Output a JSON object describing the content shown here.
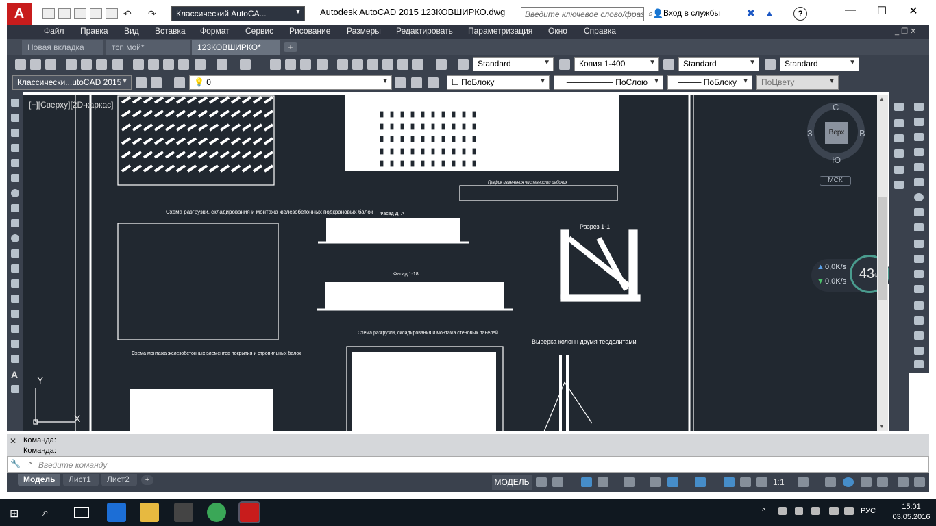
{
  "titlebar": {
    "logo": "A",
    "workspace": "Классический AutoCA...",
    "app_title": "Autodesk AutoCAD 2015    123КОВШИРКО.dwg",
    "search_placeholder": "Введите ключевое слово/фразу",
    "signin": "Вход в службы",
    "help": "?",
    "minimize": "—",
    "maximize": "☐",
    "close": "✕"
  },
  "menu": [
    "Файл",
    "Правка",
    "Вид",
    "Вставка",
    "Формат",
    "Сервис",
    "Рисование",
    "Размеры",
    "Редактировать",
    "Параметризация",
    "Окно",
    "Справка"
  ],
  "tabs": [
    {
      "label": "Новая вкладка",
      "active": false
    },
    {
      "label": "тсп мой*",
      "active": false
    },
    {
      "label": "123КОВШИРКО*",
      "active": true
    }
  ],
  "toolbar1": {
    "text_style": "Standard",
    "dim_style": "Копия 1-400",
    "table_style": "Standard",
    "mleader_style": "Standard"
  },
  "toolbar2": {
    "workspace": "Классически...utoCAD 2015",
    "layer": "0",
    "color": "ПоБлоку",
    "linetype": "ПоСлою",
    "lineweight": "ПоБлоку",
    "plotstyle": "ПоЦвету"
  },
  "viewport": {
    "label": "[−][Сверху][2D-каркас]",
    "ucs_y": "Y",
    "ucs_x": "X"
  },
  "viewcube": {
    "n": "С",
    "s": "Ю",
    "w": "З",
    "e": "В",
    "top": "Верх",
    "ucs": "МСК"
  },
  "drawing_text": {
    "t1": "График изменения численности рабочих",
    "t2": "Фасад Д–А",
    "t3": "Разрез 1-1",
    "t4": "Фасад 1-18",
    "t5": "Схема разгрузки, складирования и монтажа железобетонных подкрановых балок",
    "t6": "Схема монтажа железобетонных элементов покрытия и стропильных балок",
    "t7": "Схема разгрузки, складирования и монтажа стеновых панелей",
    "t8": "Выверка колонн двумя теодолитами"
  },
  "network": {
    "up": "0,0K/s",
    "down": "0,0K/s",
    "percent": "43",
    "percent_sign": "%"
  },
  "command": {
    "line1": "Команда:",
    "line2": "Команда:",
    "placeholder": "Введите команду"
  },
  "layouts": [
    {
      "label": "Модель",
      "active": true
    },
    {
      "label": "Лист1",
      "active": false
    },
    {
      "label": "Лист2",
      "active": false
    }
  ],
  "status": {
    "model": "МОДЕЛЬ",
    "scale": "1:1"
  },
  "taskbar": {
    "lang": "РУС",
    "time": "15:01",
    "date": "03.05.2016"
  },
  "colors": {
    "accent": "#c81c1c",
    "canvas": "#212830",
    "chrome": "#3a414d"
  }
}
